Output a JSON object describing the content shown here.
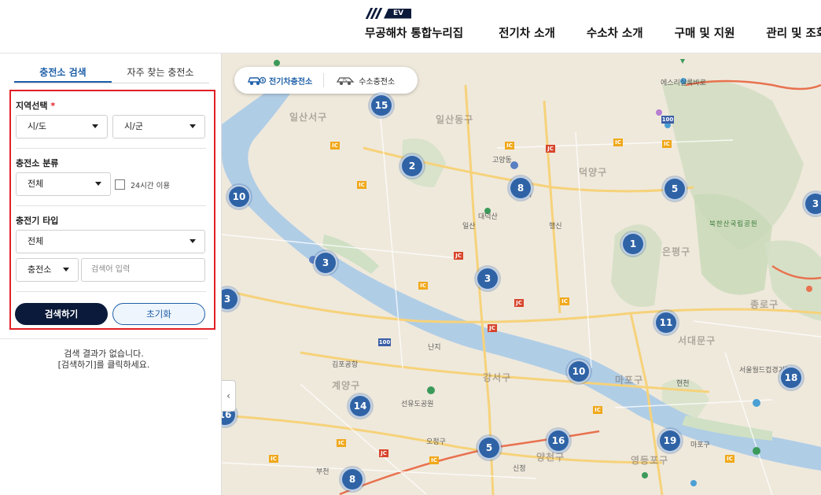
{
  "header": {
    "logo_text": "EV",
    "nav": [
      "무공해차 통합누리집",
      "전기차 소개",
      "수소차 소개",
      "구매 및 지원",
      "관리 및 조회"
    ]
  },
  "sidebar": {
    "tabs": [
      "충전소 검색",
      "자주 찾는 충전소"
    ],
    "region": {
      "label": "지역선택",
      "required_mark": "*",
      "sido": "시/도",
      "sigun": "시/군"
    },
    "category": {
      "label": "충전소 분류",
      "value": "전체",
      "checkbox_label": "24시간 이용"
    },
    "charger_type": {
      "label": "충전기 타입",
      "value": "전체"
    },
    "search_type": "충전소",
    "search_placeholder": "검색어 입력",
    "search_button": "검색하기",
    "reset_button": "초기화",
    "result_line1": "검색 결과가 없습니다.",
    "result_line2": "[검색하기]를 클릭하세요."
  },
  "map": {
    "tabs": [
      "전기차충전소",
      "수소충전소"
    ],
    "collapse_icon": "‹",
    "clusters": [
      "15",
      "2",
      "8",
      "5",
      "10",
      "1",
      "3",
      "3",
      "3",
      "11",
      "10",
      "18",
      "14",
      "16",
      "5",
      "19",
      "8",
      "16",
      "3"
    ],
    "places": [
      "일산서구",
      "일산동구",
      "덕양구",
      "은평구",
      "고양동",
      "서대문구",
      "강서구",
      "계양구",
      "양천구",
      "영등포구",
      "마포구",
      "종로구",
      "마포구"
    ],
    "labels": [
      "에스리실록바로",
      "대덕산",
      "일산",
      "지축",
      "북한산국립공원",
      "김포공항",
      "난지",
      "서울월드컵경기장",
      "선유도공원",
      "신정",
      "행신",
      "현천",
      "오정구",
      "부천"
    ],
    "road_marks": [
      "IC",
      "JC",
      "100"
    ],
    "colors": {
      "river": "#b0cde6",
      "cluster": "#2f63a6",
      "primary_button": "#0b1a3a",
      "accent": "#1e5fa8",
      "highlight_border": "#e21f26"
    }
  }
}
